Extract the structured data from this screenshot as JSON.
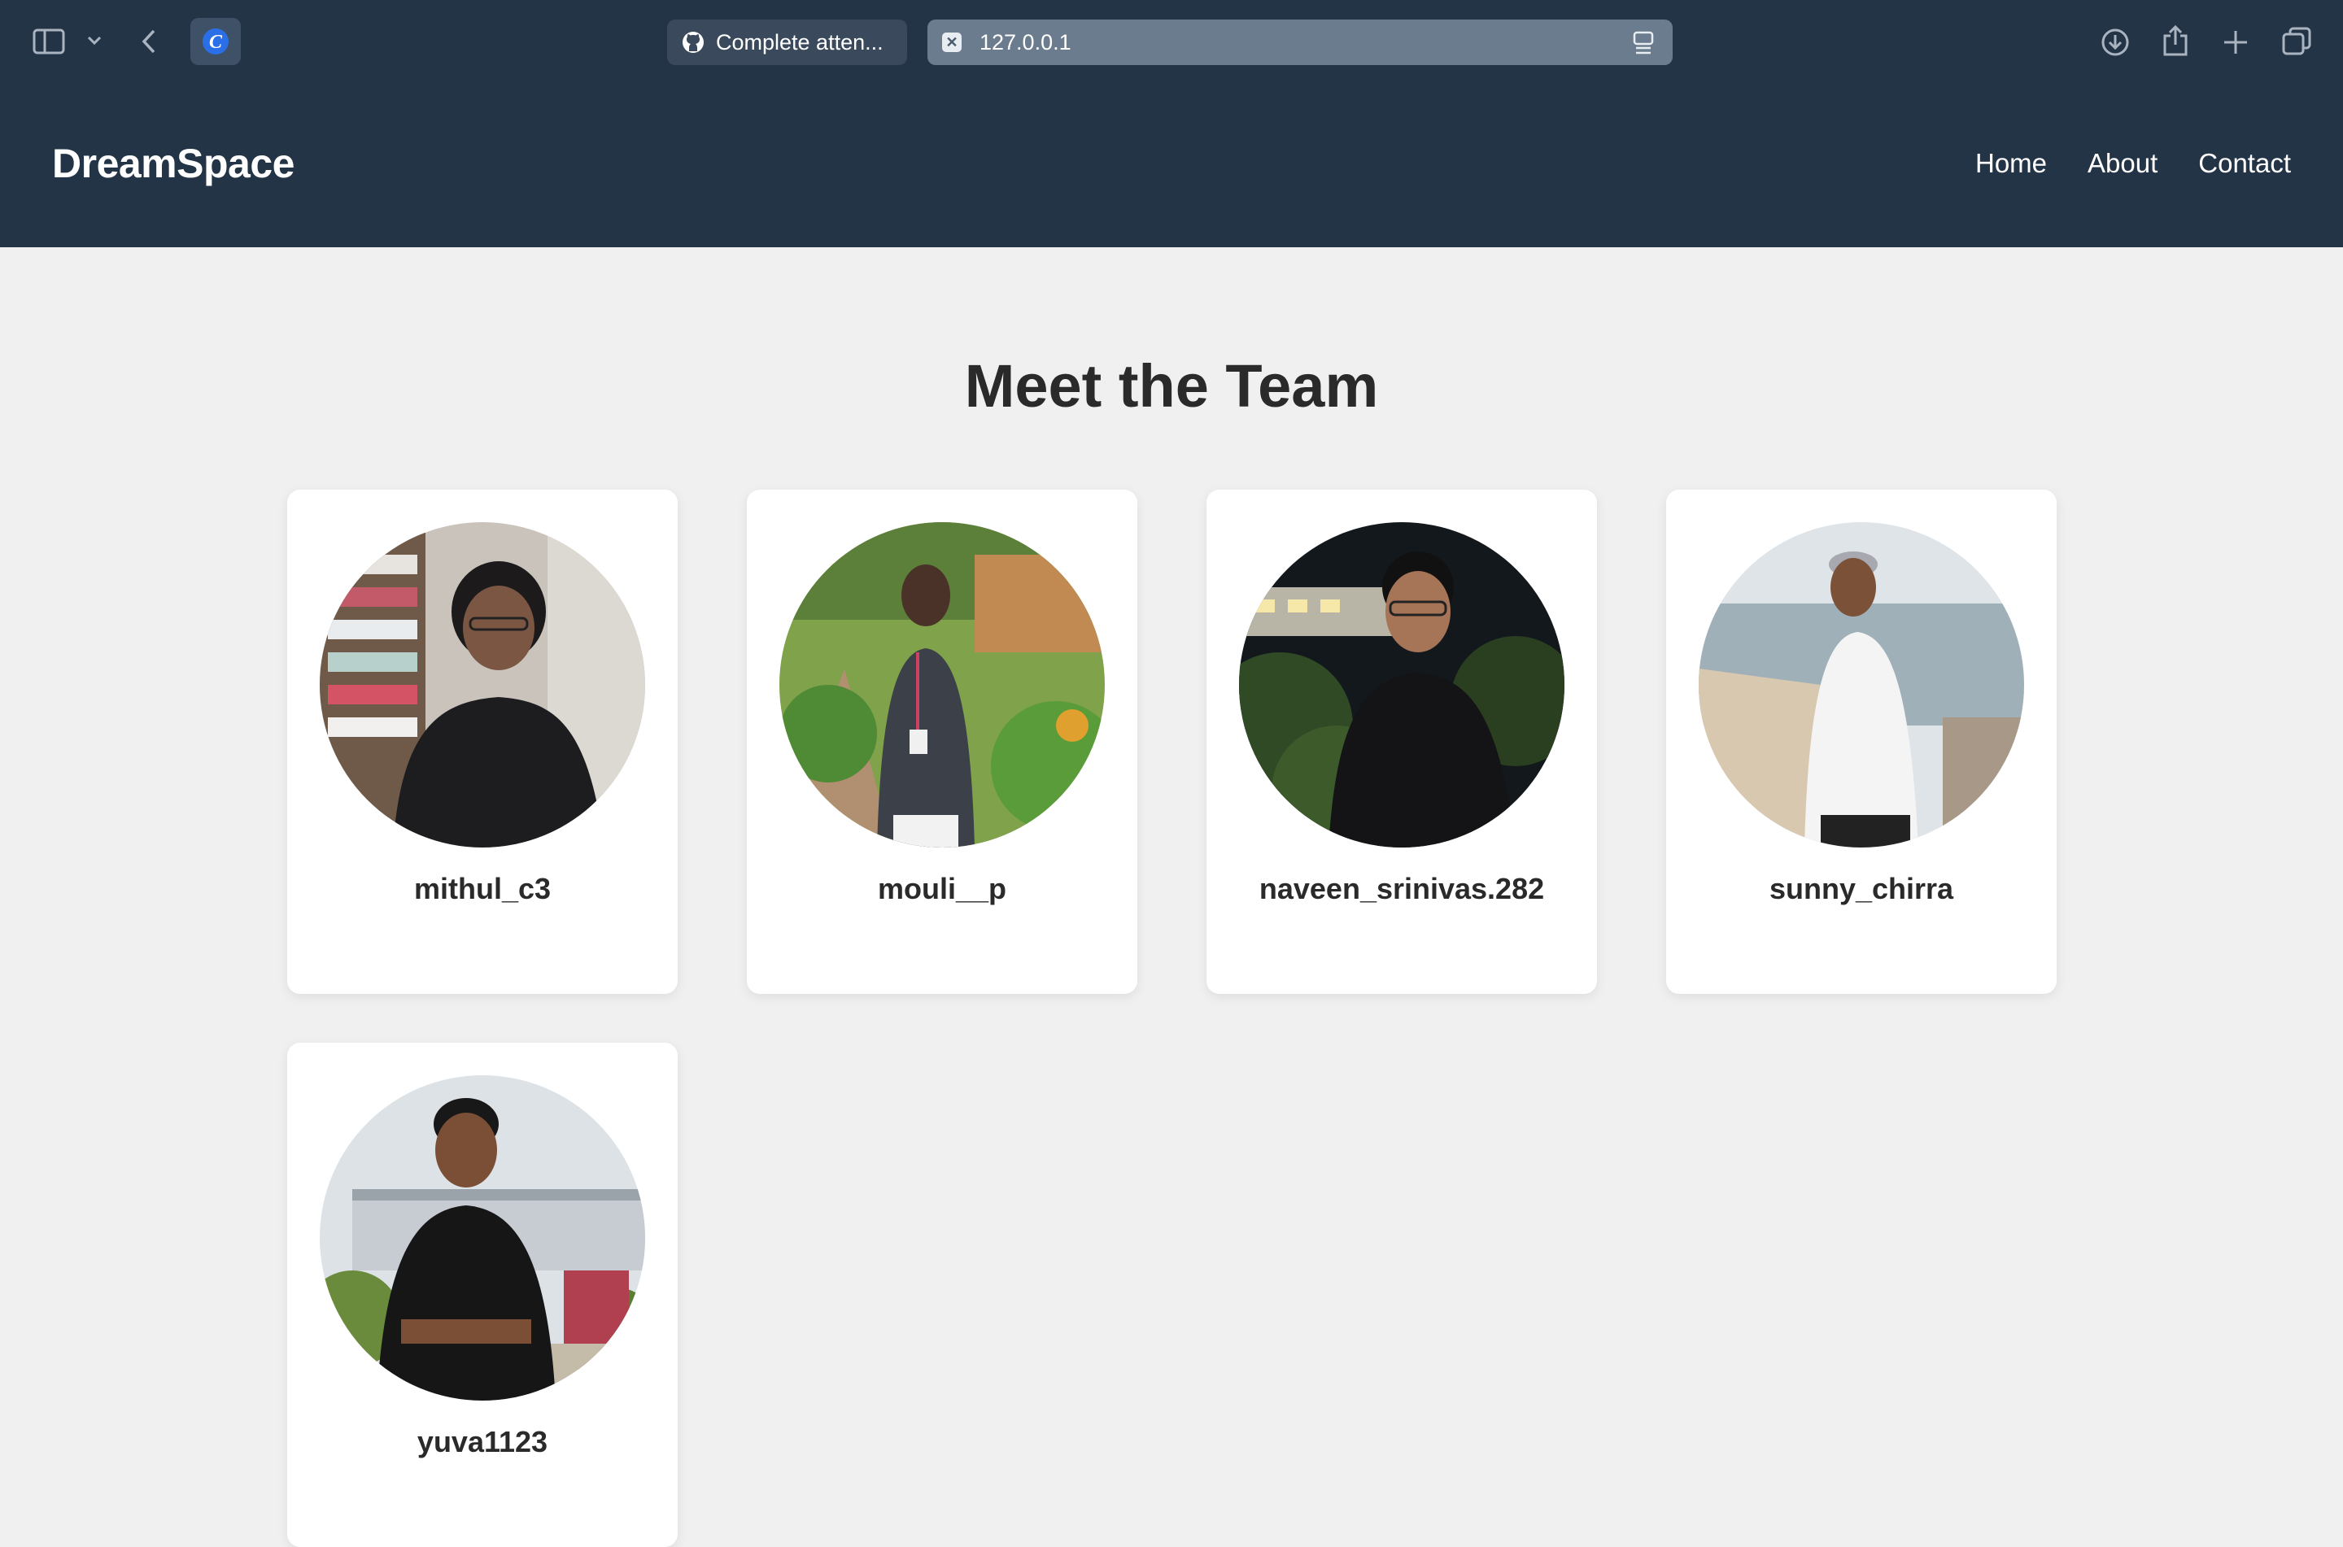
{
  "browser": {
    "tabs": [
      {
        "label": "Complete atten...",
        "icon": "github-icon"
      },
      {
        "label": "127.0.0.1",
        "icon": "close-tab-icon"
      }
    ],
    "close_glyph": "✕"
  },
  "site": {
    "brand": "DreamSpace",
    "nav": [
      "Home",
      "About",
      "Contact"
    ]
  },
  "team": {
    "title": "Meet the Team",
    "members": [
      {
        "name": "mithul_c3"
      },
      {
        "name": "mouli__p"
      },
      {
        "name": "naveen_srinivas.282"
      },
      {
        "name": "sunny_chirra"
      },
      {
        "name": "yuva1123"
      }
    ]
  },
  "colors": {
    "header_bg": "#243447",
    "page_bg": "#f0f0f0",
    "card_bg": "#ffffff",
    "title_text": "#2a2a2a"
  }
}
